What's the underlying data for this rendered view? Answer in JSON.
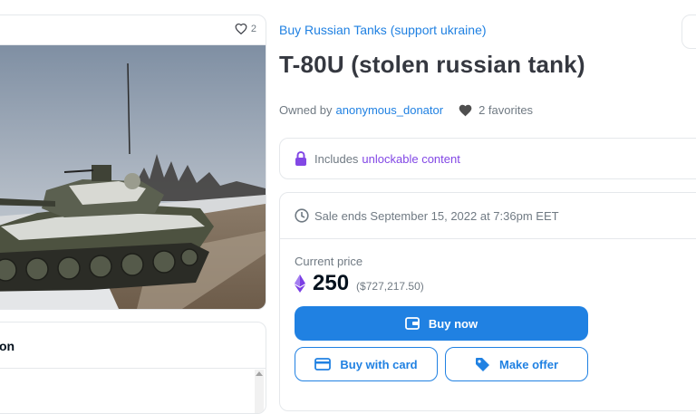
{
  "media": {
    "favorite_count": "2"
  },
  "description": {
    "title": "on"
  },
  "item": {
    "collection": "Buy Russian Tanks (support ukraine)",
    "title": "T-80U (stolen russian tank)",
    "owner_prefix": "Owned by",
    "owner": "anonymous_donator",
    "favorites": "2 favorites"
  },
  "unlockable": {
    "prefix": "Includes",
    "link": "unlockable content"
  },
  "sale": {
    "ends": "Sale ends September 15, 2022 at 7:36pm EET",
    "price_label": "Current price",
    "price": "250",
    "price_usd": "($727,217.50)",
    "buy_now": "Buy now",
    "buy_with_card": "Buy with card",
    "make_offer": "Make offer"
  },
  "colors": {
    "accent": "#2081e2",
    "unlockable": "#8247e5",
    "muted_text": "#707a83",
    "heading": "#353840"
  },
  "icons": [
    "heart-outline-icon",
    "heart-filled-icon",
    "lock-icon",
    "clock-icon",
    "ethereum-icon",
    "wallet-icon",
    "credit-card-icon",
    "tag-icon"
  ]
}
